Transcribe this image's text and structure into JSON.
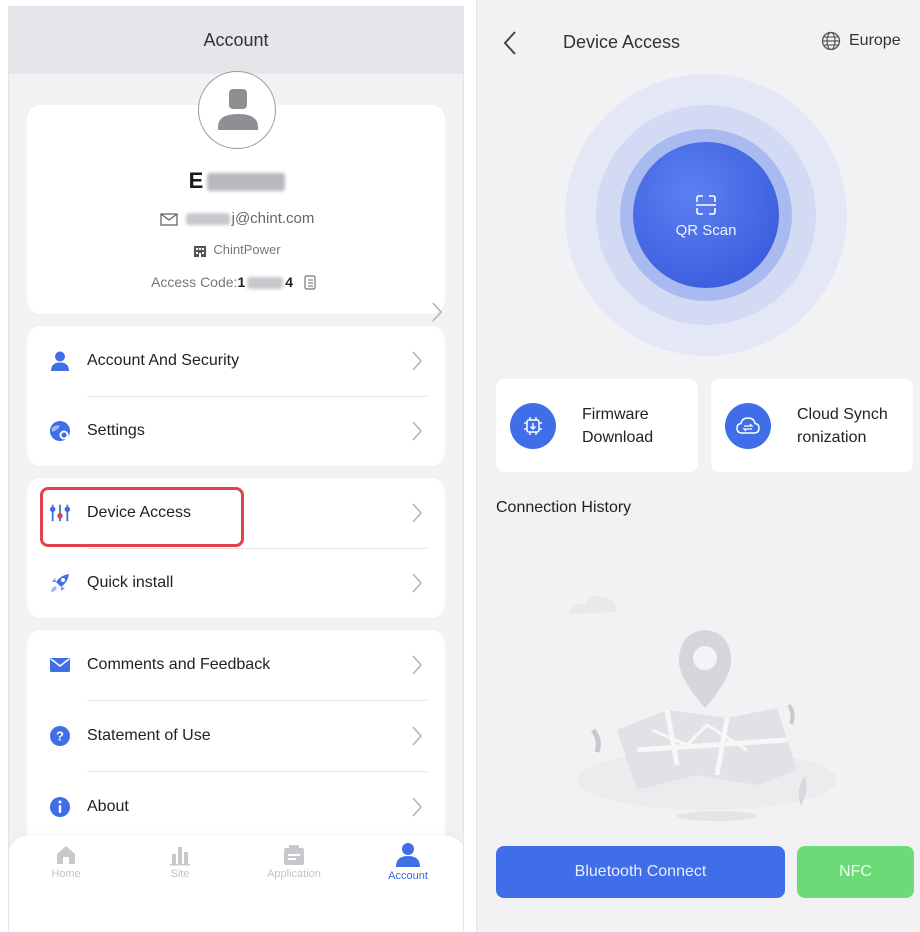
{
  "left_screen": {
    "header_title": "Account",
    "profile": {
      "name_prefix": "E",
      "email_suffix": "j@chint.com",
      "company": "ChintPower",
      "access_code_label": "Access Code:",
      "access_code_start": "1",
      "access_code_end": "4"
    },
    "menu_groups": [
      {
        "items": [
          {
            "label": "Account And Security"
          },
          {
            "label": "Settings"
          }
        ]
      },
      {
        "items": [
          {
            "label": "Device Access"
          },
          {
            "label": "Quick install"
          }
        ]
      },
      {
        "items": [
          {
            "label": "Comments and Feedback"
          },
          {
            "label": "Statement of Use"
          },
          {
            "label": "About"
          }
        ]
      }
    ],
    "tabbar": [
      {
        "label": "Home",
        "icon": "home-icon"
      },
      {
        "label": "Site",
        "icon": "site-icon"
      },
      {
        "label": "Application",
        "icon": "application-icon"
      },
      {
        "label": "Account",
        "icon": "account-icon",
        "active": true
      }
    ],
    "highlight_color": "#e0444a"
  },
  "right_screen": {
    "title": "Device Access",
    "region": "Europe",
    "qr_label": "QR Scan",
    "features": [
      {
        "line1": "Firmware",
        "line2": "Download",
        "icon": "firmware-download-icon"
      },
      {
        "line1": "Cloud Synch",
        "line2": "ronization",
        "icon": "cloud-sync-icon"
      }
    ],
    "connection_history_title": "Connection History",
    "bluetooth_button": "Bluetooth Connect",
    "nfc_button": "NFC",
    "colors": {
      "primary": "#3f6ee8",
      "nfc": "#6dda78",
      "background": "#f2f2f4"
    }
  }
}
